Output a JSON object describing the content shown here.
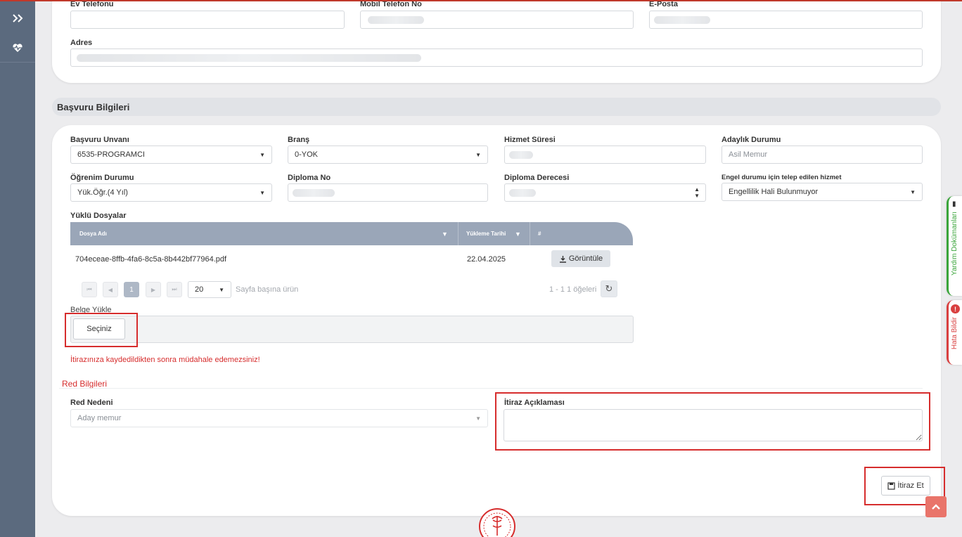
{
  "sidebar": {
    "expand_icon": "double-chevron-right-icon",
    "health_icon": "heart-pulse-icon"
  },
  "contact": {
    "home_phone_label": "Ev Telefonu",
    "mobile_phone_label": "Mobil Telefon No",
    "email_label": "E-Posta",
    "address_label": "Adres"
  },
  "section": {
    "title": "Başvuru Bilgileri"
  },
  "application": {
    "title_label": "Başvuru Unvanı",
    "title_value": "6535-PROGRAMCI",
    "branch_label": "Branş",
    "branch_value": "0-YOK",
    "service_label": "Hizmet Süresi",
    "candidacy_label": "Adaylık Durumu",
    "candidacy_placeholder": "Asil Memur",
    "education_label": "Öğrenim Durumu",
    "education_value": "Yük.Öğr.(4 Yıl)",
    "diploma_no_label": "Diploma No",
    "diploma_degree_label": "Diploma Derecesi",
    "disability_label": "Engel durumu için telep edilen hizmet",
    "disability_value": "Engellilik Hali Bulunmuyor"
  },
  "files": {
    "title": "Yüklü Dosyalar",
    "columns": [
      "Dosya Adı",
      "Yükleme Tarihi",
      "#"
    ],
    "rows": [
      {
        "name": "704eceae-8ffb-4fa6-8c5a-8b442bf77964.pdf",
        "date": "22.04.2025",
        "action": "Görüntüle"
      }
    ],
    "pager": {
      "first": "⏮",
      "prev": "◀",
      "current_page": "1",
      "next": "▶",
      "last": "⏭",
      "page_size": "20",
      "page_size_label": "Sayfa başına ürün",
      "range_text": "1 - 1 1 öğeleri"
    }
  },
  "upload": {
    "label": "Belge Yükle",
    "button": "Seçiniz"
  },
  "warning": "İtirazınıza kaydedildikten sonra müdahale edemezsiniz!",
  "rejection": {
    "title": "Red Bilgileri",
    "reason_label": "Red Nedeni",
    "reason_value": "Aday memur",
    "objection_label": "İtiraz Açıklaması",
    "objection_value": ""
  },
  "actions": {
    "objection_button": "İtiraz Et",
    "save_icon": "save-icon",
    "scroll_top_icon": "chevron-up-icon"
  },
  "side_tabs": {
    "help": "Yardım Dokümanları",
    "report": "Hata Bildir"
  },
  "colors": {
    "sidebar": "#5b6a7e",
    "grid_header": "#9aa6b8",
    "highlight": "#d62d2d",
    "help_tab": "#3aa53a",
    "report_tab": "#d94040"
  }
}
